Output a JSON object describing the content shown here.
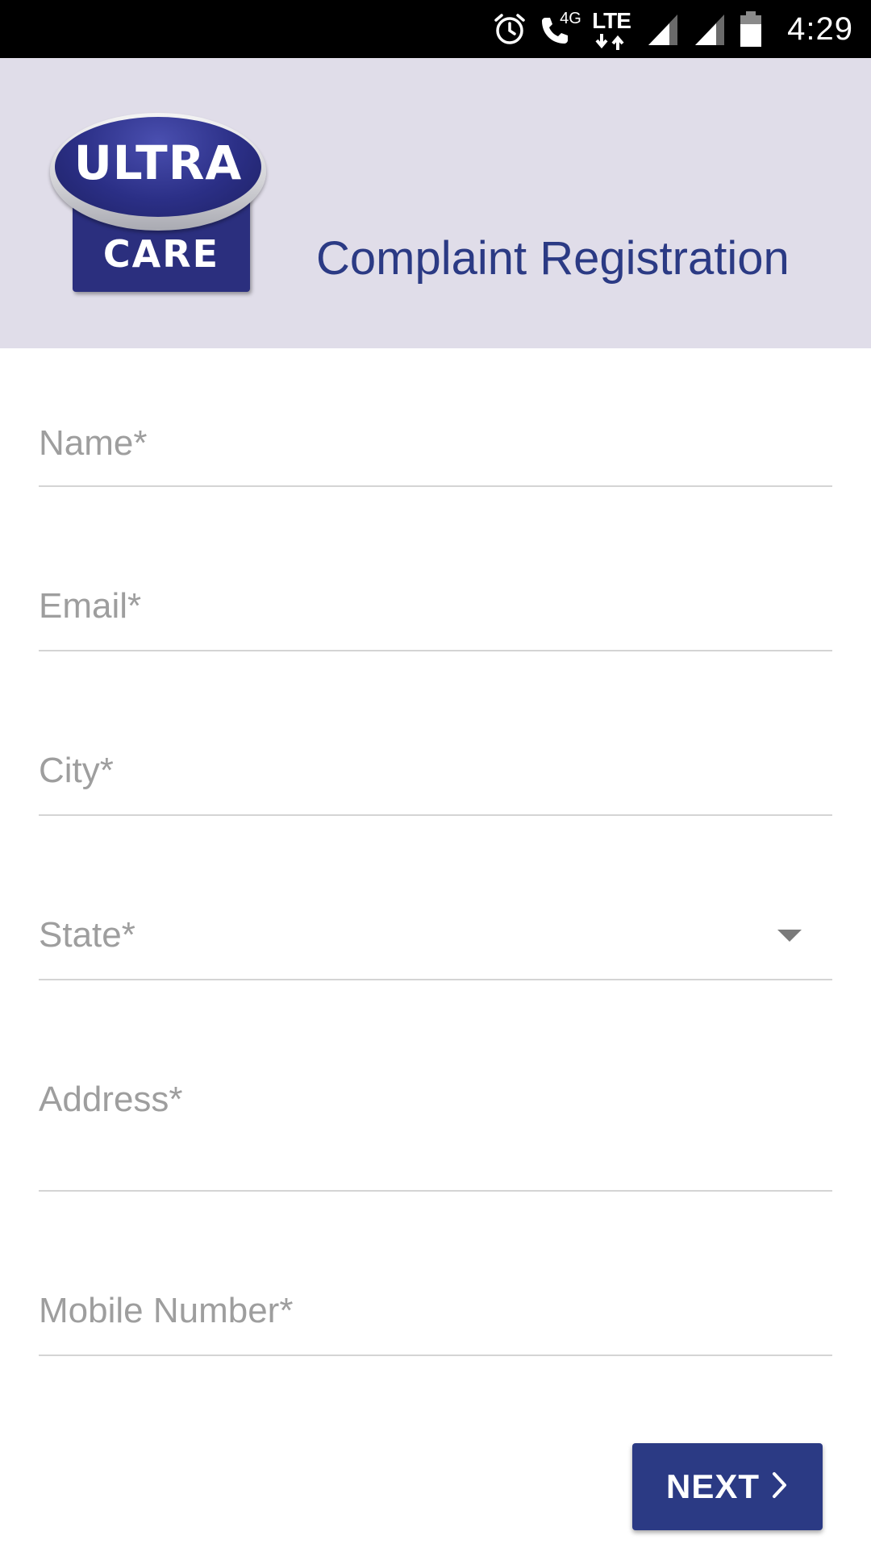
{
  "status_bar": {
    "time": "4:29",
    "network_label": "LTE",
    "network_sub": "4G",
    "icons": [
      "alarm-icon",
      "wifi-calling-icon",
      "lte-icon",
      "signal-icon",
      "signal-icon",
      "battery-icon"
    ]
  },
  "header": {
    "logo_text_top": "ULTRA",
    "logo_text_bottom": "CARE",
    "title": "Complaint Registration",
    "background": "#e0dde9",
    "title_color": "#2b3a84"
  },
  "form": {
    "fields": [
      {
        "placeholder": "Name*",
        "value": ""
      },
      {
        "placeholder": "Email*",
        "value": ""
      },
      {
        "placeholder": "City*",
        "value": ""
      },
      {
        "placeholder": "State*",
        "value": "",
        "type": "select"
      },
      {
        "placeholder": "Address*",
        "value": ""
      },
      {
        "placeholder": "Mobile Number*",
        "value": ""
      }
    ]
  },
  "actions": {
    "next_label": "NEXT",
    "next_icon": "chevron-right-icon",
    "button_color": "#2b3a84"
  }
}
